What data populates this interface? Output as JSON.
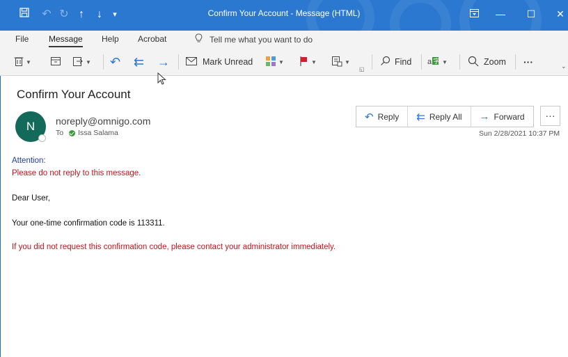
{
  "window": {
    "title": "Confirm Your Account  -  Message (HTML)",
    "accent_color": "#2b78d0"
  },
  "quick_access": {
    "icons": [
      "save-icon",
      "undo-icon",
      "redo-icon",
      "up-arrow-icon",
      "down-arrow-icon",
      "customize-icon"
    ]
  },
  "menu": {
    "tabs": [
      {
        "label": "File"
      },
      {
        "label": "Message",
        "active": true
      },
      {
        "label": "Help"
      },
      {
        "label": "Acrobat"
      }
    ],
    "tell_me": "Tell me what you want to do"
  },
  "ribbon": {
    "mark_unread": "Mark Unread",
    "find": "Find",
    "zoom": "Zoom",
    "more": "···"
  },
  "message": {
    "subject": "Confirm Your Account",
    "avatar_initial": "N",
    "sender": "noreply@omnigo.com",
    "to_label": "To",
    "recipient": "Issa Salama",
    "date": "Sun 2/28/2021 10:37 PM",
    "actions": {
      "reply": "Reply",
      "reply_all": "Reply All",
      "forward": "Forward",
      "more": "···"
    }
  },
  "body": {
    "attention": "Attention:",
    "no_reply": "Please do not reply to this message.",
    "greeting": "Dear User,",
    "code_line": "Your one-time confirmation code is 113311.",
    "warning": "If you did not request this confirmation code, please contact your administrator immediately.",
    "colors": {
      "heading": "#1f3d99",
      "warning": "#c0141c"
    }
  }
}
